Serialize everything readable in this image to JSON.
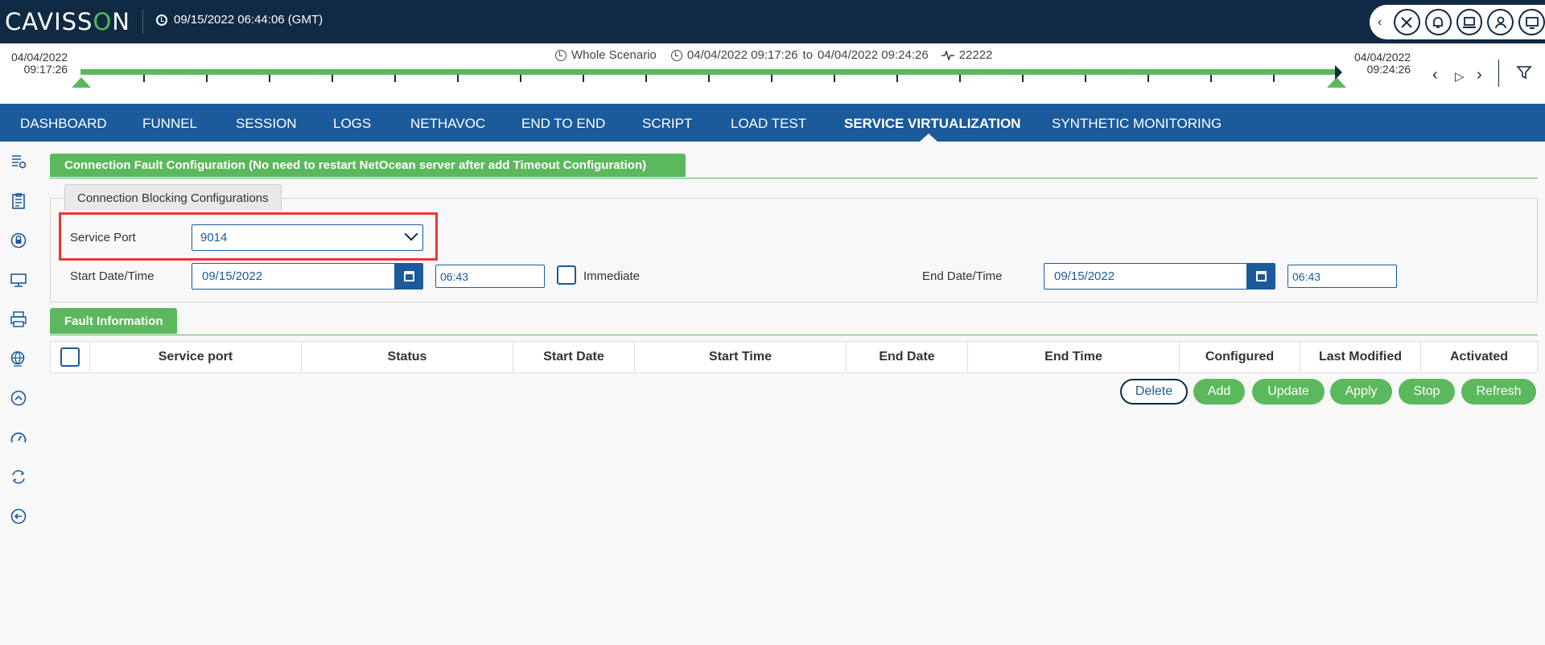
{
  "header": {
    "logo_left": "CAVISS",
    "logo_o": "O",
    "logo_right": "N",
    "datetime": "09/15/2022 06:44:06 (GMT)"
  },
  "timeline": {
    "scenario": "Whole Scenario",
    "range_start": "04/04/2022 09:17:26",
    "range_to": "to",
    "range_end": "04/04/2022 09:24:26",
    "test_id": "22222",
    "left_date": "04/04/2022",
    "left_time": "09:17:26",
    "right_date": "04/04/2022",
    "right_time": "09:24:26"
  },
  "nav": {
    "items": [
      "DASHBOARD",
      "FUNNEL",
      "SESSION",
      "LOGS",
      "NETHAVOC",
      "END TO END",
      "SCRIPT",
      "LOAD TEST",
      "SERVICE VIRTUALIZATION",
      "SYNTHETIC MONITORING"
    ],
    "active": "SERVICE VIRTUALIZATION"
  },
  "config": {
    "section_title": "Connection Fault Configuration (No need to restart NetOcean server after add Timeout Configuration)",
    "tab_label": "Connection Blocking Configurations",
    "service_port_label": "Service Port",
    "service_port_value": "9014",
    "start_label": "Start Date/Time",
    "start_date": "09/15/2022",
    "start_time": "06:43",
    "immediate_label": "Immediate",
    "end_label": "End Date/Time",
    "end_date": "09/15/2022",
    "end_time": "06:43"
  },
  "fault": {
    "section_title": "Fault Information",
    "columns": [
      "Service port",
      "Status",
      "Start Date",
      "Start Time",
      "End Date",
      "End Time",
      "Configured",
      "Last Modified",
      "Activated"
    ]
  },
  "actions": {
    "delete": "Delete",
    "add": "Add",
    "update": "Update",
    "apply": "Apply",
    "stop": "Stop",
    "refresh": "Refresh"
  },
  "colors": {
    "header_bg": "#102a43",
    "nav_bg": "#1b5a9b",
    "accent_green": "#5cb85c",
    "highlight_red": "#e53935"
  },
  "icons": {
    "sidebar": [
      "config-list-icon",
      "clipboard-icon",
      "lock-icon",
      "monitor-icon",
      "print-log-icon",
      "globe-settings-icon",
      "chevron-up-icon",
      "speedometer-icon",
      "sync-icon",
      "back-arrow-icon"
    ],
    "top_right": [
      "tools-icon",
      "bell-icon",
      "laptop-icon",
      "user-icon",
      "display-icon"
    ]
  }
}
